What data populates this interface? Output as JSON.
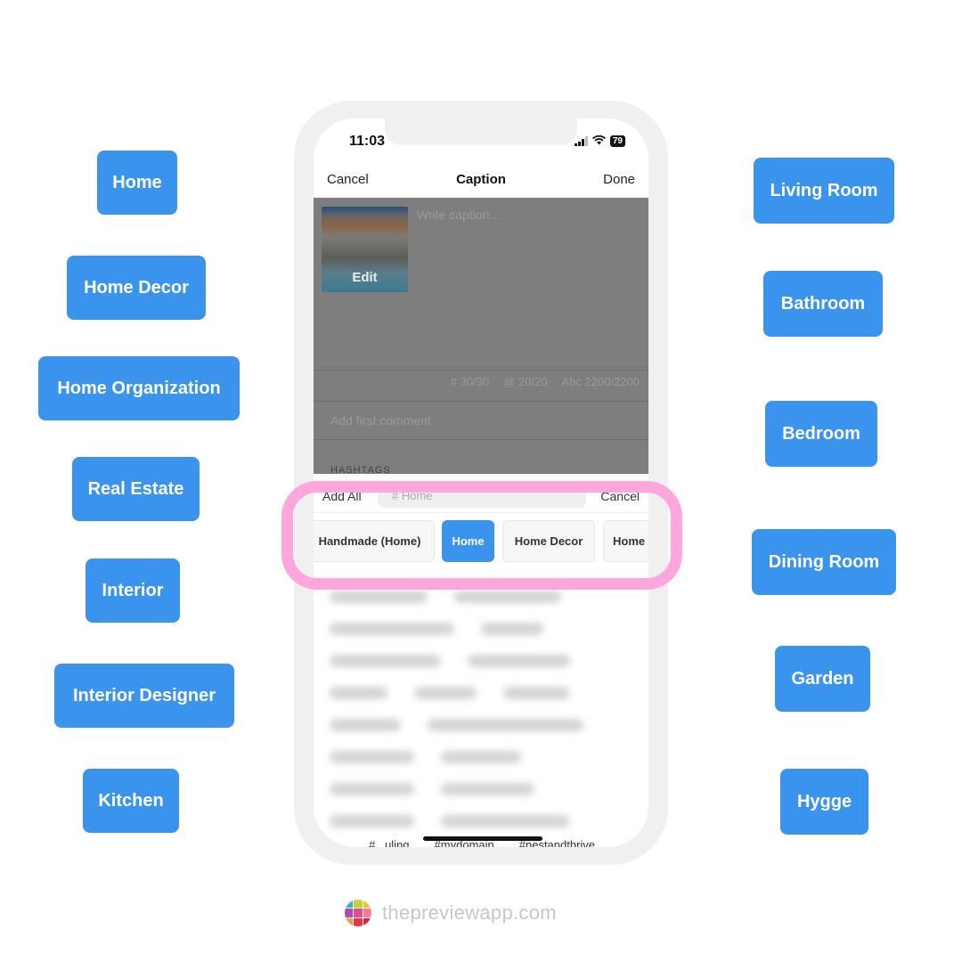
{
  "left_tags": [
    "Home",
    "Home Decor",
    "Home Organization",
    "Real Estate",
    "Interior",
    "Interior Designer",
    "Kitchen"
  ],
  "right_tags": [
    "Living Room",
    "Bathroom",
    "Bedroom",
    "Dining Room",
    "Garden",
    "Hygge"
  ],
  "phone": {
    "status": {
      "time": "11:03",
      "battery": "79"
    },
    "nav": {
      "cancel": "Cancel",
      "title": "Caption",
      "done": "Done"
    },
    "post": {
      "edit_label": "Edit",
      "caption_placeholder": "Write caption..."
    },
    "counters": {
      "hashtags": "# 30/30",
      "mentions": "@ 20/20",
      "characters": "Abc 2200/2200"
    },
    "first_comment_placeholder": "Add first comment",
    "hashtags_section_label": "HASHTAGS",
    "search_row": {
      "add_all": "Add All",
      "search_value": "# Home",
      "cancel": "Cancel"
    },
    "category_chips": [
      {
        "label": "Handmade (Home)",
        "active": false
      },
      {
        "label": "Home",
        "active": true
      },
      {
        "label": "Home Decor",
        "active": false
      },
      {
        "label": "Home",
        "active": false
      }
    ],
    "bottom_hashtags": [
      "#...uling",
      "#mydomain",
      "#nestandthrive"
    ]
  },
  "colors": {
    "tag_blue": "#3a94ee",
    "highlight_pink": "#ffa6dc"
  },
  "footer": {
    "site": "thepreviewapp.com"
  }
}
